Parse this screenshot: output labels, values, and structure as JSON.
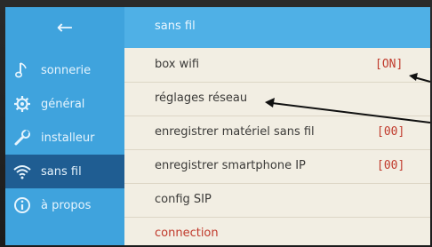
{
  "header": {
    "title": "sans fil"
  },
  "sidebar": {
    "back_glyph": "←",
    "items": [
      {
        "label": "sonnerie",
        "icon": "music-note-icon"
      },
      {
        "label": "général",
        "icon": "gear-icon"
      },
      {
        "label": "installeur",
        "icon": "wrench-icon"
      },
      {
        "label": "sans fil",
        "icon": "wifi-icon",
        "active": true
      },
      {
        "label": "à propos",
        "icon": "info-icon"
      }
    ]
  },
  "menu": {
    "rows": [
      {
        "label": "box wifi",
        "value": "[ON]"
      },
      {
        "label": "réglages réseau",
        "value": ""
      },
      {
        "label": "enregistrer matériel sans fil",
        "value": "[00]"
      },
      {
        "label": "enregistrer smartphone IP",
        "value": "[00]"
      },
      {
        "label": "config SIP",
        "value": ""
      },
      {
        "label": "connection",
        "value": ""
      }
    ]
  },
  "colors": {
    "sidebar": "#3fa3dd",
    "sidebar_active": "#1f5d92",
    "header": "#4fb0e6",
    "list_bg": "#f2eee3",
    "value_red": "#c0392b"
  }
}
